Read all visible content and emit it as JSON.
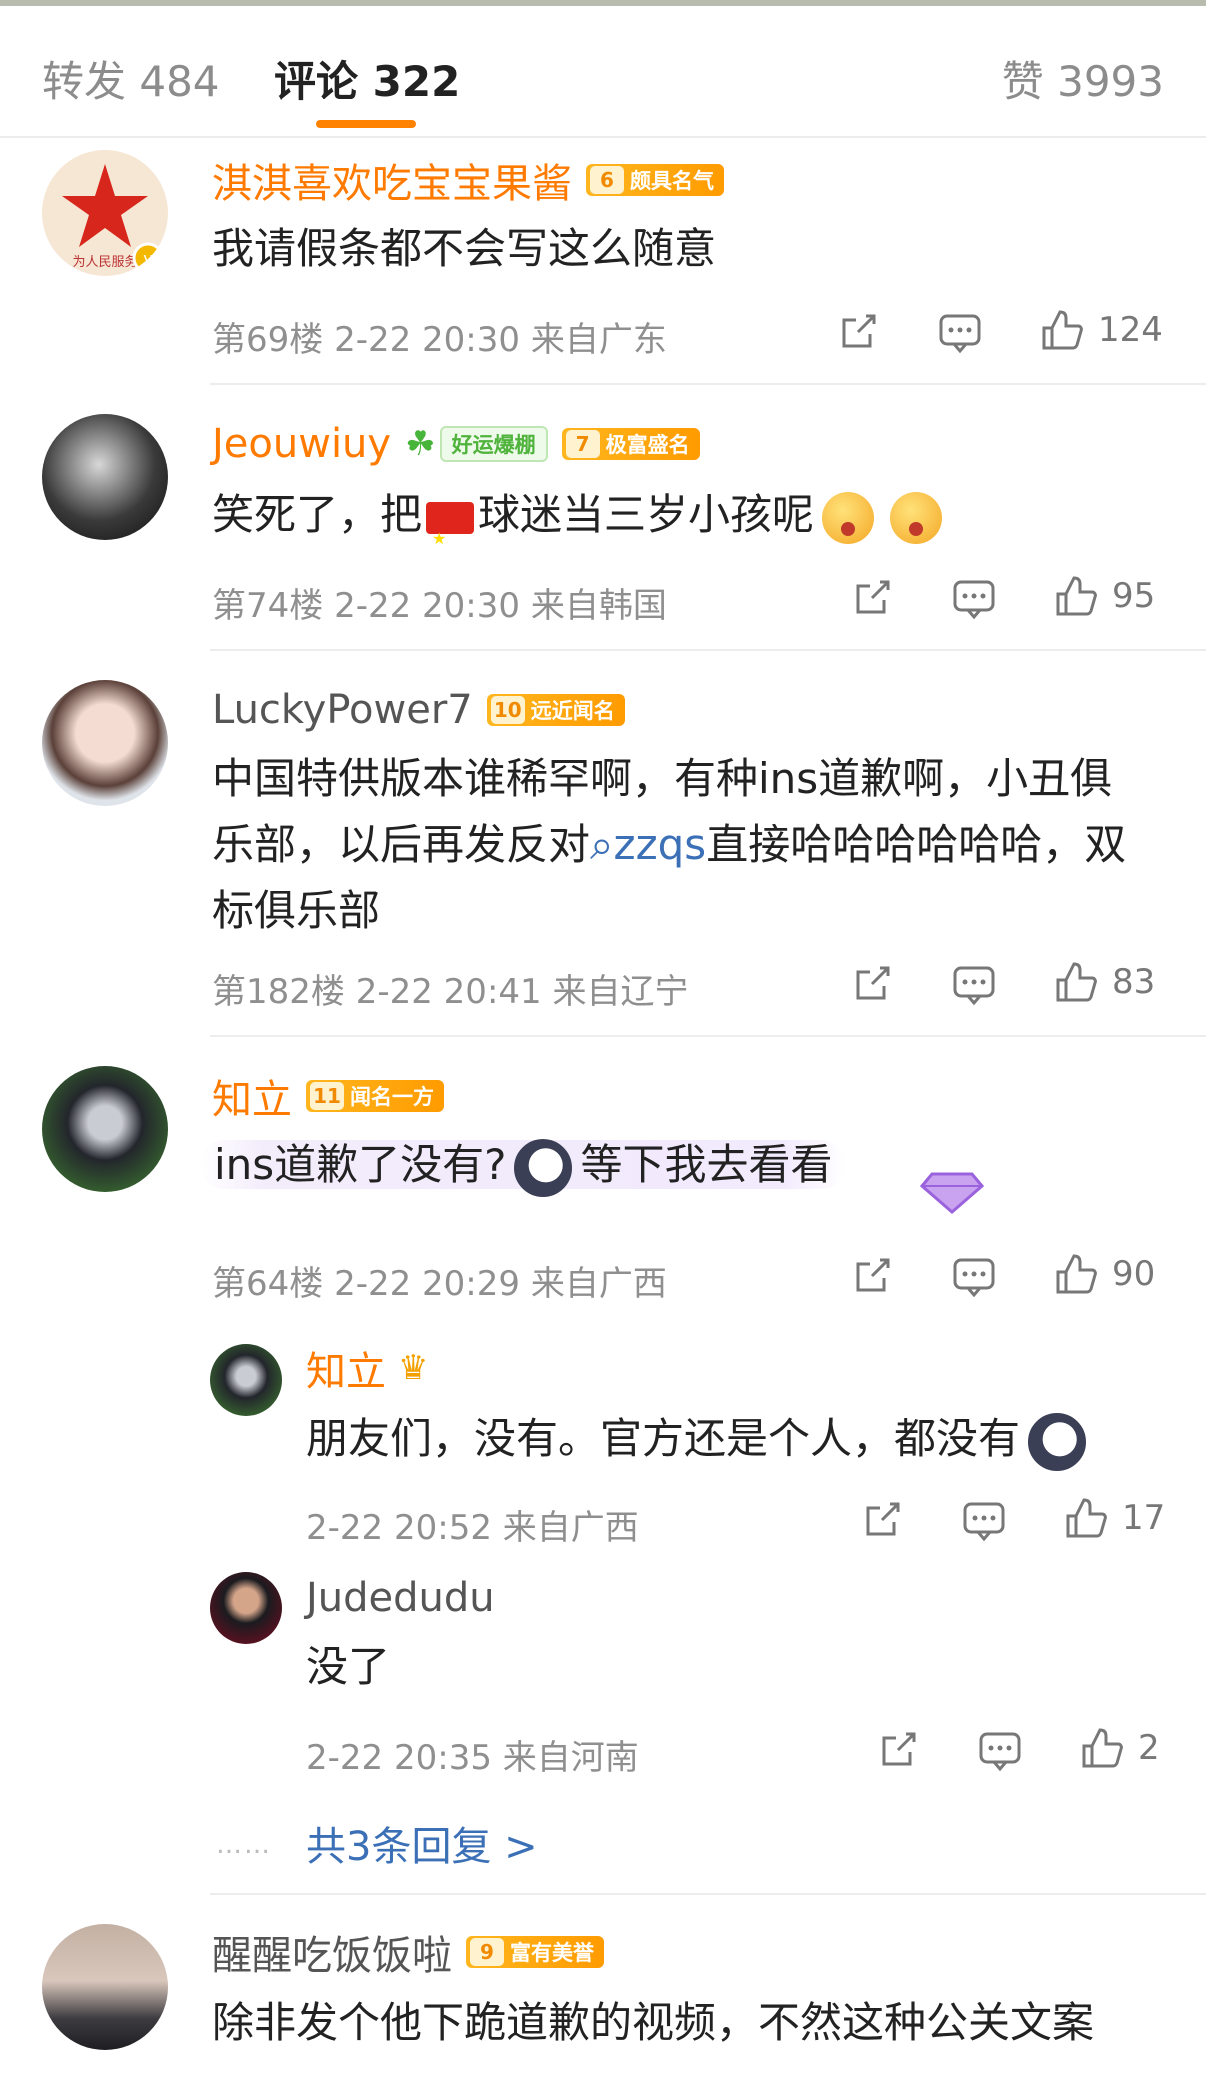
{
  "tabs": {
    "reposts": "转发 484",
    "comments": "评论 322",
    "likes": "赞 3993"
  },
  "colors": {
    "accent": "#ff8200",
    "username": "#ff7a00",
    "link": "#3b6fb6",
    "meta": "#8f8f8f"
  },
  "icons": {
    "share": "share-icon",
    "comment": "comment-icon",
    "like": "thumbs-up-icon"
  },
  "comments": [
    {
      "user": "淇淇喜欢吃宝宝果酱",
      "badge_level": "6",
      "badge_text": "颇具名气",
      "text": "我请假条都不会写这么随意",
      "meta": "第69楼 2-22 20:30 来自广东",
      "likes": "124"
    },
    {
      "user": "Jeouwiuy",
      "tag": "好运爆棚",
      "badge_level": "7",
      "badge_text": "极富盛名",
      "text_a": "笑死了，把",
      "text_b": "球迷当三岁小孩呢",
      "meta": "第74楼 2-22 20:30 来自韩国",
      "likes": "95"
    },
    {
      "user": "LuckyPower7",
      "badge_level": "10",
      "badge_text": "远近闻名",
      "text_a": "中国特供版本谁稀罕啊，有种ins道歉啊，小丑俱乐部，以后再发反对",
      "link": "zzqs",
      "text_b": "直接哈哈哈哈哈哈，双标俱乐部",
      "meta": "第182楼 2-22 20:41 来自辽宁",
      "likes": "83"
    },
    {
      "user": "知立",
      "badge_level": "11",
      "badge_text": "闻名一方",
      "text_a": "ins道歉了没有?",
      "text_b": "等下我去看看",
      "meta": "第64楼 2-22 20:29 来自广西",
      "likes": "90",
      "replies": [
        {
          "user": "知立",
          "text": "朋友们，没有。官方还是个人，都没有",
          "meta": "2-22 20:52 来自广西",
          "likes": "17"
        },
        {
          "user": "Judedudu",
          "text": "没了",
          "meta": "2-22 20:35 来自河南",
          "likes": "2"
        }
      ],
      "more_replies": "共3条回复 >"
    },
    {
      "user": "醒醒吃饭饭啦",
      "badge_level": "9",
      "badge_text": "富有美誉",
      "text": "除非发个他下跪道歉的视频，不然这种公关文案"
    }
  ]
}
